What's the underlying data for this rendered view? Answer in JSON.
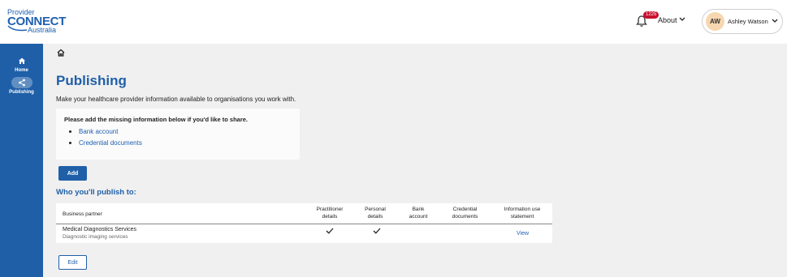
{
  "header": {
    "logo": {
      "line1": "Provider",
      "line2": "CONNECT",
      "line3": "Australia"
    },
    "notifications": {
      "count": "1225"
    },
    "about_label": "About",
    "user": {
      "initials": "AW",
      "name": "Ashley Watson"
    }
  },
  "sidebar": {
    "items": [
      {
        "label": "Home",
        "icon": "home-icon"
      },
      {
        "label": "Publishing",
        "icon": "share-icon"
      }
    ]
  },
  "main": {
    "title": "Publishing",
    "description": "Make your healthcare provider information available to organisations you work with.",
    "missing": {
      "title": "Please add the missing information below if you'd like to share.",
      "items": [
        "Bank account",
        "Credential documents"
      ]
    },
    "add_label": "Add",
    "section_heading": "Who you'll publish to:",
    "table": {
      "columns": {
        "partner": "Business partner",
        "practitioner": [
          "Practitioner",
          "details"
        ],
        "personal": [
          "Personal",
          "details"
        ],
        "bank": [
          "Bank",
          "account"
        ],
        "credential": [
          "Credential",
          "documents"
        ],
        "info": [
          "Information use",
          "statement"
        ]
      },
      "rows": [
        {
          "name": "Medical Diagnostics Services",
          "subtitle": "Diagnostic imaging services",
          "practitioner_details": true,
          "personal_details": true,
          "bank_account": false,
          "credential_documents": false,
          "info_link": "View"
        }
      ]
    },
    "edit_label": "Edit"
  },
  "colors": {
    "brand": "#1f5fa8",
    "link": "#1f5fb0",
    "badge": "#c8102e",
    "avatar": "#f6d7b0"
  }
}
